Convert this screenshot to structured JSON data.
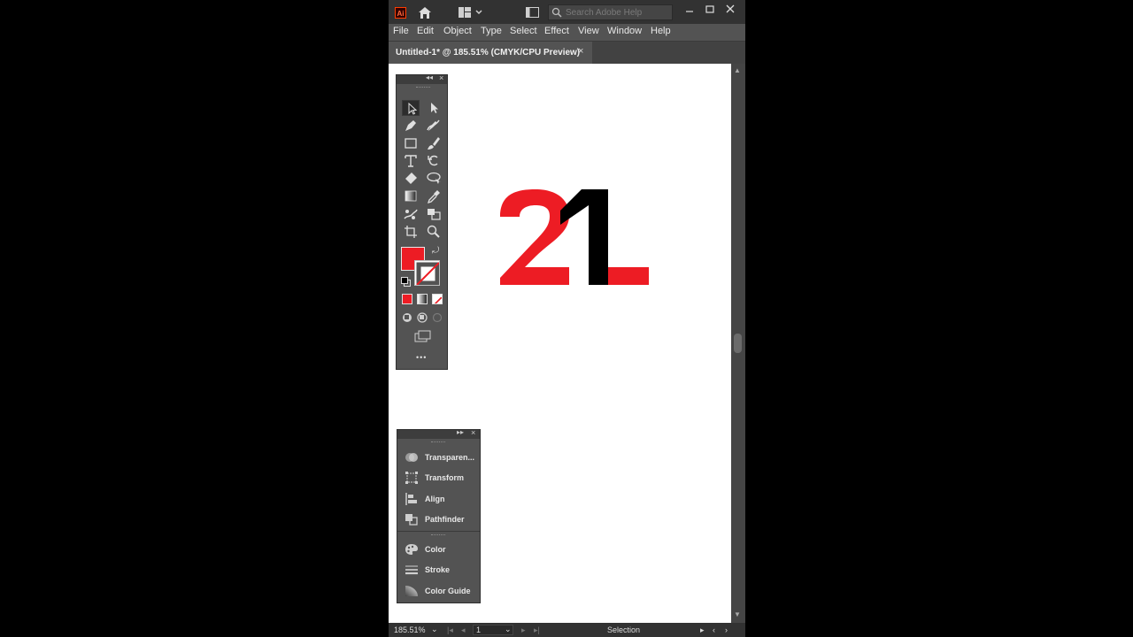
{
  "app": {
    "logo_text": "Ai",
    "brand_color": "#ff3d00"
  },
  "search": {
    "placeholder": "Search Adobe Help"
  },
  "menu": [
    "File",
    "Edit",
    "Object",
    "Type",
    "Select",
    "Effect",
    "View",
    "Window",
    "Help"
  ],
  "document": {
    "tab_title": "Untitled-1* @ 185.51% (CMYK/CPU Preview)",
    "close_glyph": "×"
  },
  "artwork": {
    "fill_red": "#ed1c24",
    "black": "#000000",
    "glyphs": "21"
  },
  "toolbar": {
    "tools": [
      "selection",
      "direct-selection",
      "pen",
      "curvature",
      "rectangle",
      "paintbrush",
      "type",
      "rotate",
      "eraser",
      "lasso",
      "gradient",
      "eyedropper",
      "puppet-warp",
      "shape-builder",
      "crop",
      "zoom"
    ],
    "fill_color": "#ed1c24",
    "more_glyph": "•••"
  },
  "panels": {
    "group1": [
      "Transparen...",
      "Transform",
      "Align",
      "Pathfinder"
    ],
    "group2": [
      "Color",
      "Stroke",
      "Color Guide"
    ]
  },
  "status": {
    "zoom": "185.51%",
    "page": "1",
    "tool": "Selection"
  }
}
